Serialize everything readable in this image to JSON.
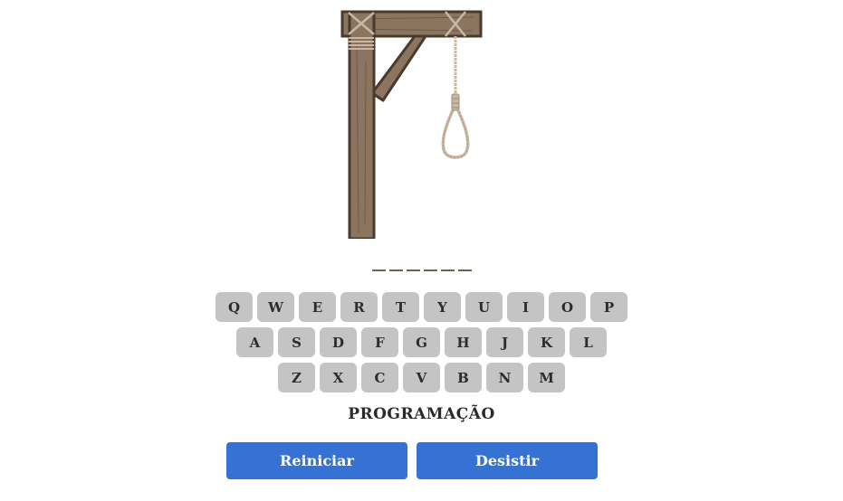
{
  "word": {
    "blanks": [
      "",
      "",
      "",
      "",
      "",
      ""
    ]
  },
  "keyboard": {
    "rows": [
      [
        "Q",
        "W",
        "E",
        "R",
        "T",
        "Y",
        "U",
        "I",
        "O",
        "P"
      ],
      [
        "A",
        "S",
        "D",
        "F",
        "G",
        "H",
        "J",
        "K",
        "L"
      ],
      [
        "Z",
        "X",
        "C",
        "V",
        "B",
        "N",
        "M"
      ]
    ]
  },
  "category": "PROGRAMAÇÃO",
  "buttons": {
    "restart": "Reiniciar",
    "quit": "Desistir"
  },
  "colors": {
    "key_bg": "#c4c4c4",
    "button_bg": "#3572d3",
    "wood": "#8b7560",
    "rope": "#c9b8a3",
    "blank_line": "#6f6350"
  },
  "icons": {
    "gallows": "gallows-with-noose"
  }
}
